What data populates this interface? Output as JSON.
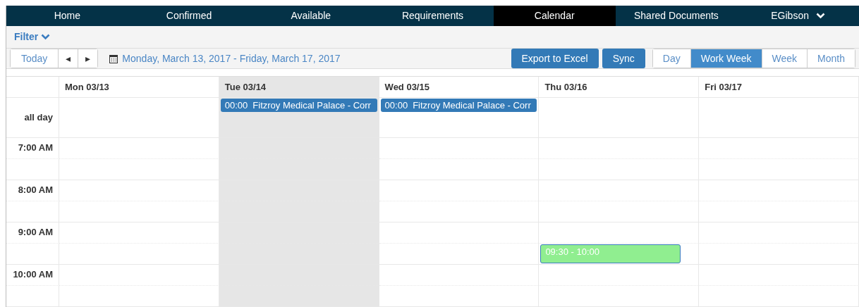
{
  "nav": {
    "items": [
      {
        "label": "Home",
        "selected": false
      },
      {
        "label": "Confirmed",
        "selected": false
      },
      {
        "label": "Available",
        "selected": false
      },
      {
        "label": "Requirements",
        "selected": false
      },
      {
        "label": "Calendar",
        "selected": true
      },
      {
        "label": "Shared Documents",
        "selected": false
      }
    ],
    "user": {
      "label": "EGibson"
    }
  },
  "filter": {
    "label": "Filter"
  },
  "toolbar": {
    "today": "Today",
    "prev": "◂",
    "next": "▸",
    "range": "Monday, March 13, 2017 - Friday, March 17, 2017",
    "actions": [
      "Export to Excel",
      "Sync"
    ],
    "views": [
      {
        "label": "Day",
        "selected": false
      },
      {
        "label": "Work Week",
        "selected": true
      },
      {
        "label": "Week",
        "selected": false
      },
      {
        "label": "Month",
        "selected": false
      }
    ]
  },
  "calendar": {
    "all_day_label": "all day",
    "days": [
      {
        "label": "Mon 03/13",
        "today": false
      },
      {
        "label": "Tue 03/14",
        "today": true,
        "all_day_events": [
          {
            "time": "00:00",
            "title": "Fitzroy Medical Palace - Corr",
            "color": "#337ab7"
          }
        ]
      },
      {
        "label": "Wed 03/15",
        "today": false,
        "all_day_events": [
          {
            "time": "00:00",
            "title": "Fitzroy Medical Palace - Corr",
            "color": "#337ab7"
          }
        ]
      },
      {
        "label": "Thu 03/16",
        "today": false,
        "events": [
          {
            "time": "09:30 - 10:00",
            "color": "#90ee90"
          }
        ]
      },
      {
        "label": "Fri 03/17",
        "today": false
      }
    ],
    "hours": [
      "7:00 AM",
      "8:00 AM",
      "9:00 AM",
      "10:00 AM"
    ]
  }
}
